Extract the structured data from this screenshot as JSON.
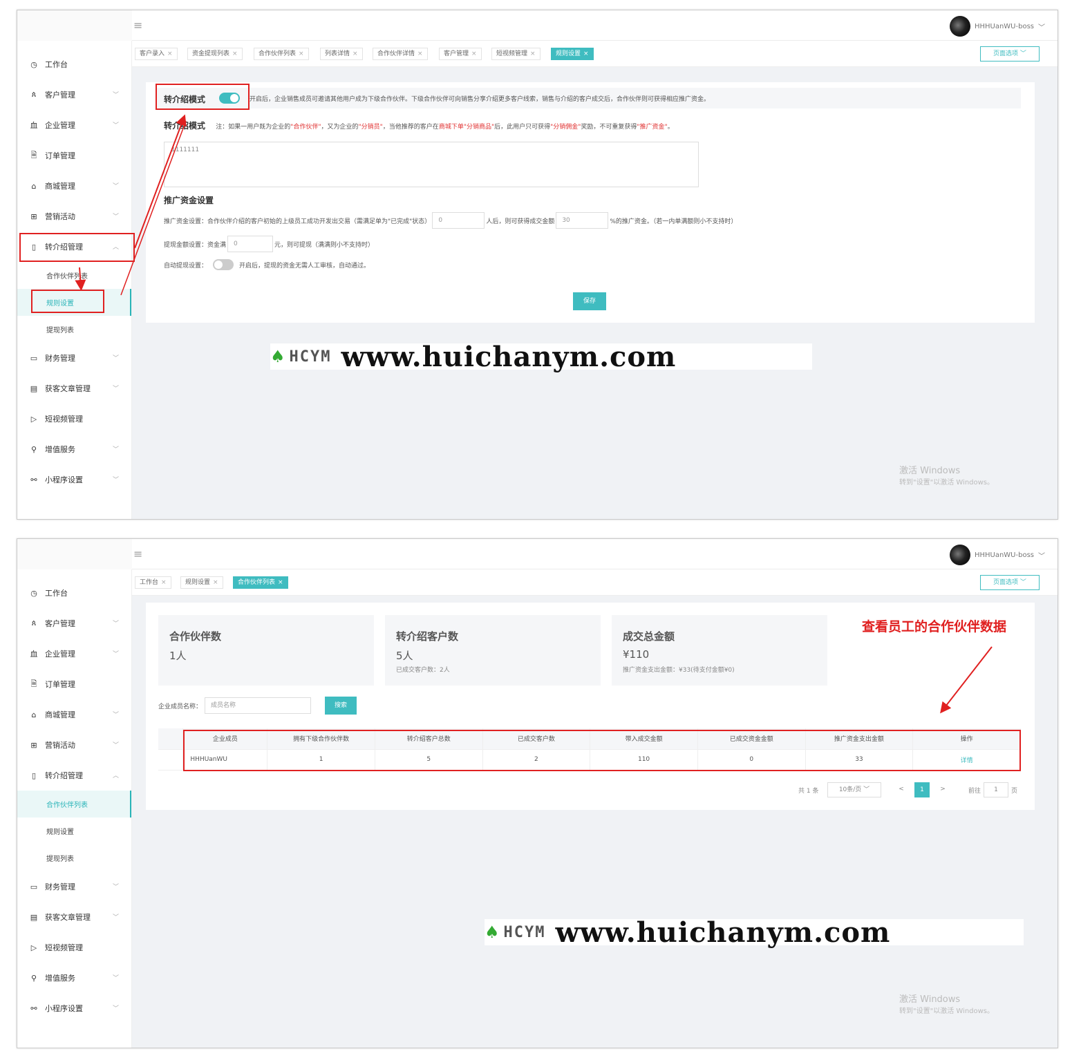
{
  "common": {
    "username": "HHHUanWU-boss",
    "page_options": "页面选项",
    "hamburger": "≡",
    "win_title": "激活 Windows",
    "win_sub": "转到\"设置\"以激活 Windows。",
    "watermark_logo": "HCYM",
    "watermark_url": "www.huichanym.com",
    "menu": [
      {
        "icon": "clock-icon",
        "glyph": "◷",
        "label": "工作台",
        "chev": ""
      },
      {
        "icon": "customer-icon",
        "glyph": "ጰ",
        "label": "客户管理",
        "chev": "﹀"
      },
      {
        "icon": "bank-icon",
        "glyph": "⾎",
        "label": "企业管理",
        "chev": "﹀"
      },
      {
        "icon": "document-icon",
        "glyph": "🗎",
        "label": "订单管理",
        "chev": ""
      },
      {
        "icon": "shop-icon",
        "glyph": "⌂",
        "label": "商城管理",
        "chev": "﹀"
      },
      {
        "icon": "gift-icon",
        "glyph": "⊞",
        "label": "营销活动",
        "chev": "﹀"
      },
      {
        "icon": "phone-icon",
        "glyph": "▯",
        "label": "转介绍管理",
        "chev": "︿"
      }
    ],
    "submenu": [
      "合作伙伴列表",
      "规则设置",
      "提现列表"
    ],
    "menu2": [
      {
        "icon": "wallet-icon",
        "glyph": "▭",
        "label": "财务管理",
        "chev": "﹀"
      },
      {
        "icon": "article-icon",
        "glyph": "▤",
        "label": "获客文章管理",
        "chev": "﹀"
      },
      {
        "icon": "video-icon",
        "glyph": "▷",
        "label": "短视频管理",
        "chev": ""
      },
      {
        "icon": "search-icon",
        "glyph": "⚲",
        "label": "增值服务",
        "chev": "﹀"
      },
      {
        "icon": "link-icon",
        "glyph": "⚯",
        "label": "小程序设置",
        "chev": "﹀"
      }
    ]
  },
  "shot1": {
    "tabs": [
      "客户录入",
      "资金提现列表",
      "合作伙伴列表",
      "列表详情",
      "合作伙伴详情",
      "客户管理",
      "短视频管理",
      "规则设置"
    ],
    "active_tab": 7,
    "mode_label": "转介绍模式",
    "mode_desc": "开启后，企业销售成员可邀请其他用户成为下级合作伙伴。下级合作伙伴可向销售分享介绍更多客户线索，销售与介绍的客户成交后，合作伙伴则可获得相应推广资金。",
    "mode_label2": "转介绍模式",
    "note_prefix": "注：如果一用户既为企业的",
    "note_red1": "\"合作伙伴\"",
    "note_mid1": "，又为企业的",
    "note_red2": "\"分销员\"",
    "note_mid2": "，当他推荐的客户在",
    "note_red3": "商城下单\"分销商品\"",
    "note_mid3": "后，此用户只可获得",
    "note_red4": "\"分销佣金\"",
    "note_mid4": "奖励，不可重复获得",
    "note_red5": "\"推广资金\"",
    "note_end": "。",
    "textarea_value": "1111111",
    "section_title": "推广资金设置",
    "fund_label": "推广资金设置：",
    "fund_text1": "合作伙伴介绍的客户初始的上级员工成功开发出交易（需满足单为\"已完成\"状态）",
    "fund_input1": "0",
    "fund_text2": "人后，则可获得成交金额",
    "fund_input2": "30",
    "fund_text3": "%的推广资金。（若一内单满额则小不支持时）",
    "withdraw_label": "提现金额设置：",
    "withdraw_pre": "资金满",
    "withdraw_input": "0",
    "withdraw_text": "元，则可提现（满满则小不支持时）",
    "auto_label": "自动提现设置：",
    "auto_text": "开启后，提现的资金无需人工审核，自动通过。",
    "save_label": "保存"
  },
  "shot2": {
    "tabs": [
      "工作台",
      "规则设置",
      "合作伙伴列表"
    ],
    "active_tab": 2,
    "stats": [
      {
        "title": "合作伙伴数",
        "value": "1人",
        "sub": ""
      },
      {
        "title": "转介绍客户数",
        "value": "5人",
        "sub": "已成交客户数：2人"
      },
      {
        "title": "成交总金额",
        "value": "¥110",
        "sub": "推广资金支出金额：¥33(待支付金额¥0)"
      }
    ],
    "annotation": "查看员工的合作伙伴数据",
    "search_label": "企业成员名称：",
    "search_placeholder": "成员名称",
    "search_button": "搜索",
    "columns": [
      "企业成员",
      "拥有下级合作伙伴数",
      "转介绍客户总数",
      "已成交客户数",
      "带入成交金额",
      "已成交资金金额",
      "推广资金支出金额",
      "操作"
    ],
    "rows": [
      [
        "HHHUanWU",
        "1",
        "5",
        "2",
        "110",
        "0",
        "33",
        "详情"
      ]
    ],
    "pagination": {
      "total": "共 1 条",
      "page_size": "10条/页",
      "current": "1",
      "goto_label": "前往",
      "goto_value": "1",
      "page_suffix": "页",
      "prev": "<",
      "next": ">"
    }
  }
}
